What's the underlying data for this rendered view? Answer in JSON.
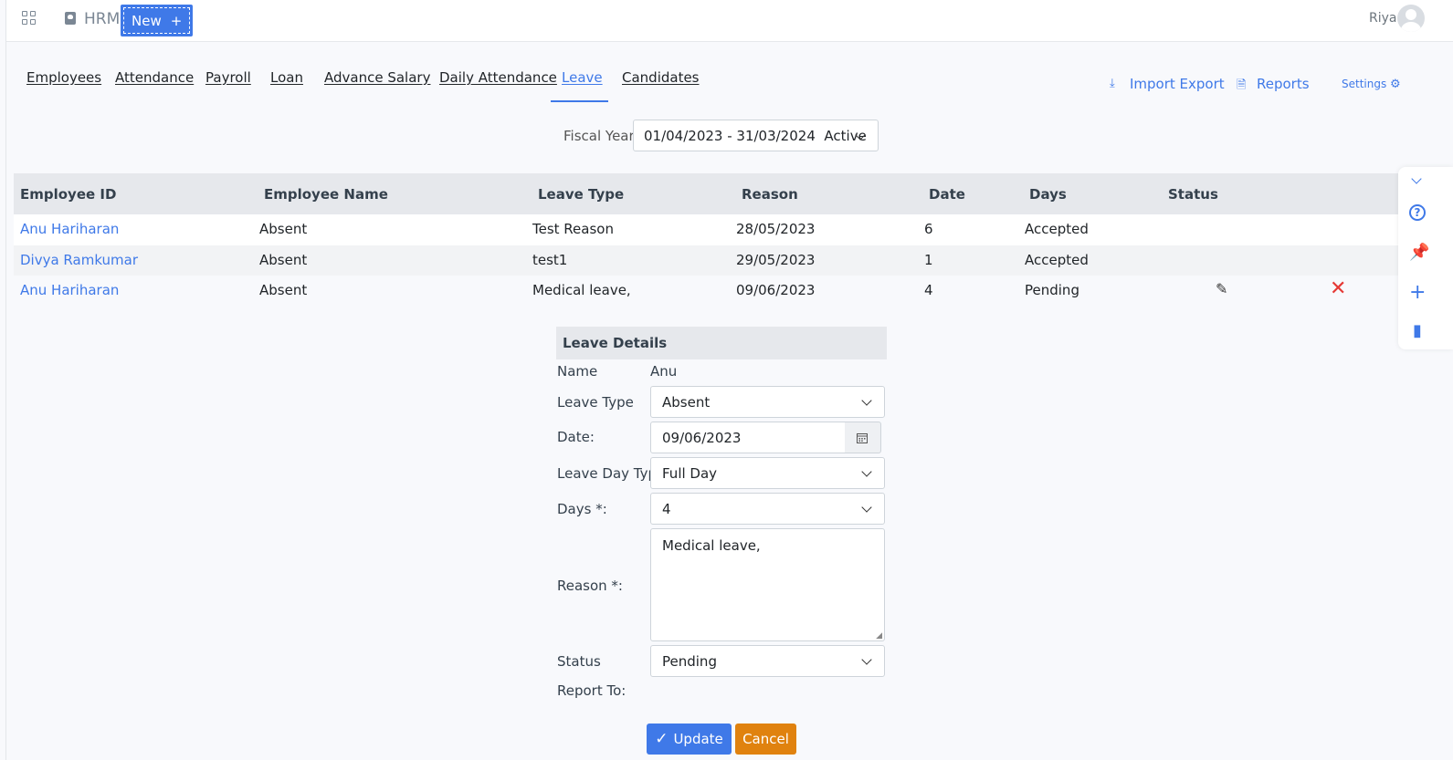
{
  "header": {
    "app_name": "HRM",
    "new_label": "New",
    "new_icon": "+",
    "user_name": "Riya"
  },
  "tabs": [
    {
      "label": "Employees",
      "active": false
    },
    {
      "label": "Attendance",
      "active": false
    },
    {
      "label": "Payroll",
      "active": false
    },
    {
      "label": "Loan",
      "active": false
    },
    {
      "label": "Advance Salary",
      "active": false
    },
    {
      "label": "Daily Attendance",
      "active": false
    },
    {
      "label": "Leave",
      "active": true
    },
    {
      "label": "Candidates",
      "active": false
    }
  ],
  "actions": {
    "import_export": "Import Export",
    "reports": "Reports",
    "settings": "Settings"
  },
  "fiscal": {
    "label": "Fiscal Year:",
    "value": "01/04/2023 - 31/03/2024  Active"
  },
  "table": {
    "headers": [
      "Employee ID",
      "Employee Name",
      "Leave Type",
      "Reason",
      "Date",
      "Days",
      "Status"
    ],
    "rows": [
      {
        "name": "Anu Hariharan",
        "leave_type": "Absent",
        "reason": "Test Reason",
        "date": "28/05/2023",
        "days": "6",
        "status": "Accepted"
      },
      {
        "name": "Divya Ramkumar",
        "leave_type": "Absent",
        "reason": "test1",
        "date": "29/05/2023",
        "days": "1",
        "status": "Accepted"
      },
      {
        "name": "Anu Hariharan",
        "leave_type": "Absent",
        "reason": "Medical leave,",
        "date": "09/06/2023",
        "days": "4",
        "status": "Pending"
      }
    ]
  },
  "form": {
    "title": "Leave Details",
    "name_label": "Name",
    "name_value": "Anu",
    "leave_type_label": "Leave Type",
    "leave_type_value": "Absent",
    "date_label": "Date:",
    "date_value": "09/06/2023",
    "leave_day_type_label": "Leave Day Type",
    "leave_day_type_value": "Full Day",
    "days_label": "Days *:",
    "days_value": "4",
    "reason_label": "Reason *:",
    "reason_value": "Medical leave,",
    "status_label": "Status",
    "status_value": "Pending",
    "report_to_label": "Report To:",
    "update_label": "Update",
    "cancel_label": "Cancel"
  },
  "colors": {
    "accent": "#3f79e8",
    "danger": "#e53935",
    "cancel": "#e0820f"
  }
}
